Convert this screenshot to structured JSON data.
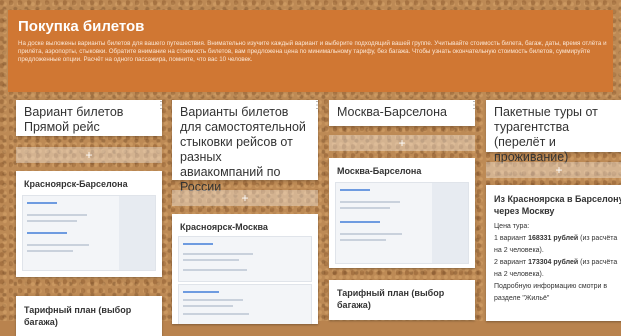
{
  "header": {
    "title": "Покупка билетов",
    "description": "На доске выложены варианты билетов для вашего путешествия. Внимательно изучите каждый вариант и выберите подходящий вашей группе. Учитывайте стоимость билета, багаж, даты, время отлёта и прилёта, аэропорты, стыковки. Обратите внимание на стоимость билетов, вам предложена цена по минимальному тарифу, без багажа. Чтобы узнать окончательную стоимость билетов, суммируйте предложенные опции. Расчёт на одного пассажира, помните, что вас 10 человек."
  },
  "columns": [
    {
      "title": "Вариант билетов Прямой рейс",
      "add": "+",
      "cards": [
        {
          "title": "Красноярск-Барселона"
        },
        {
          "title": "Тарифный план (выбор багажа)"
        }
      ]
    },
    {
      "title": "Варианты билетов для самостоятельной стыковки рейсов от разных авиакомпаний по России",
      "add": "+",
      "cards": [
        {
          "title": "Красноярск-Москва"
        }
      ]
    },
    {
      "title": "Москва-Барселона",
      "add": "+",
      "cards": [
        {
          "title": "Москва-Барселона"
        },
        {
          "title": "Тарифный план (выбор багажа)"
        }
      ]
    },
    {
      "title": "Пакетные туры от турагентства (перелёт и проживание)",
      "add": "+",
      "tour": {
        "title": "Из Красноярска в Барселону через Москву",
        "price_label": "Цена тура:",
        "v1_a": "1 вариант ",
        "v1_price": "168331 рублей",
        "v1_b": " (из расчёта на 2 человека).",
        "v2_a": "2 вариант ",
        "v2_price": "173304 рублей",
        "v2_b": " (из расчёта на 2 человека).",
        "more": "Подробную информацию смотри в разделе \"Жильё\""
      }
    }
  ],
  "colors": {
    "header_bg": "#d07733",
    "cork": "#bd8a55"
  }
}
